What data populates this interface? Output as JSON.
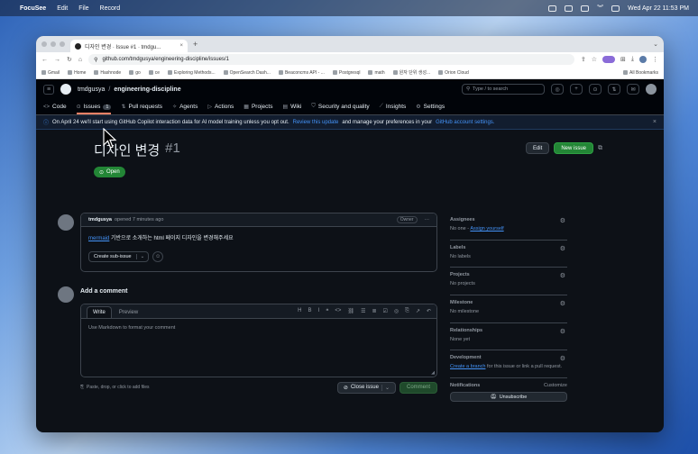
{
  "menubar": {
    "app": "FocuSee",
    "menus": [
      "Edit",
      "File",
      "Record"
    ],
    "clock": "Wed Apr 22  11:53 PM"
  },
  "browser": {
    "tab_title": "디자인 변경 · Issue #1 · tmdgu...",
    "url": "github.com/tmdgusya/engineering-discipline/issues/1",
    "bookmarks": [
      "Gmail",
      "Home",
      "Hashnode",
      "go",
      "ce",
      "Exploring Methods...",
      "OpenSearch Dash...",
      "Beaconcms API - ...",
      "Postgresql",
      "math",
      "원자 단위 생성...",
      "Orion Cloud"
    ],
    "all_bookmarks": "All Bookmarks"
  },
  "github": {
    "owner": "tmdgusya",
    "repo": "engineering-discipline",
    "search_placeholder": "Type / to search",
    "nav": [
      {
        "label": "Code",
        "icon": "<>"
      },
      {
        "label": "Issues",
        "icon": "⊙",
        "count": "1"
      },
      {
        "label": "Pull requests",
        "icon": "⇅"
      },
      {
        "label": "Agents",
        "icon": "✧"
      },
      {
        "label": "Actions",
        "icon": "▷"
      },
      {
        "label": "Projects",
        "icon": "▦"
      },
      {
        "label": "Wiki",
        "icon": "▤"
      },
      {
        "label": "Security and quality",
        "icon": "⛉"
      },
      {
        "label": "Insights",
        "icon": "⟋"
      },
      {
        "label": "Settings",
        "icon": "⚙"
      }
    ]
  },
  "banner": {
    "text_before": "On April 24 we'll start using GitHub Copilot interaction data for AI model training unless you opt out.",
    "link1": "Review this update",
    "text_mid": "and manage your preferences in your",
    "link2": "GitHub account settings."
  },
  "issue": {
    "title": "디자인 변경",
    "number": "#1",
    "state": "Open",
    "edit_label": "Edit",
    "new_issue_label": "New issue"
  },
  "comment": {
    "author": "tmdgusya",
    "meta": "opened 7 minutes ago",
    "role": "Owner",
    "link": "mermaid",
    "body": "기반으로 소개하는 html 페이지 디자인을 변경해주세요",
    "sub_issue_label": "Create sub-issue"
  },
  "composer": {
    "title": "Add a comment",
    "tab_write": "Write",
    "tab_preview": "Preview",
    "placeholder": "Use Markdown to format your comment",
    "paste_hint": "Paste, drop, or click to add files",
    "close_issue_label": "Close issue",
    "comment_label": "Comment"
  },
  "sidebar": {
    "assignees": {
      "heading": "Assignees",
      "value": "No one -",
      "link": "Assign yourself"
    },
    "labels": {
      "heading": "Labels",
      "value": "No labels"
    },
    "projects": {
      "heading": "Projects",
      "value": "No projects"
    },
    "milestone": {
      "heading": "Milestone",
      "value": "No milestone"
    },
    "relationships": {
      "heading": "Relationships",
      "value": "None yet"
    },
    "development": {
      "heading": "Development",
      "link": "Create a branch",
      "value": "for this issue or link a pull request."
    },
    "notifications": {
      "heading": "Notifications",
      "customize": "Customize",
      "button": "Unsubscribe"
    }
  },
  "colors": {
    "accent_link": "#4493f8",
    "open_green": "#238636",
    "gh_bg": "#0d1117",
    "active_tab_underline": "#f78166"
  }
}
